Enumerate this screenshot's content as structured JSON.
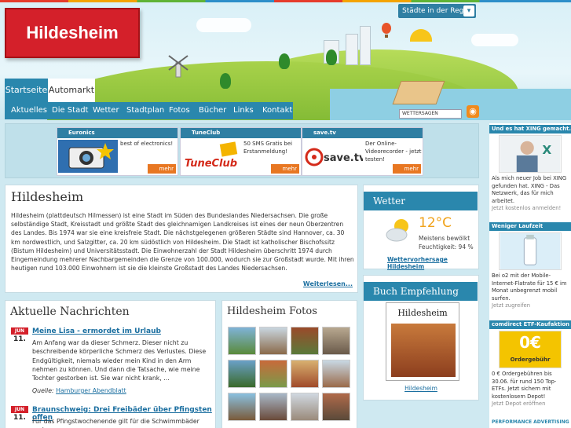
{
  "header": {
    "logo_text": "Hildesheim",
    "region_button": "Städte in der Region",
    "wetter_badge": "WETTERSAGEN"
  },
  "tabs": [
    {
      "label": "Startseite"
    },
    {
      "label": "Automarkt"
    }
  ],
  "subnav": [
    {
      "label": "Aktuelles"
    },
    {
      "label": "Die Stadt"
    },
    {
      "label": "Wetter"
    },
    {
      "label": "Stadtplan"
    },
    {
      "label": "Fotos"
    },
    {
      "label": "Bücher"
    },
    {
      "label": "Links"
    },
    {
      "label": "Kontakt"
    }
  ],
  "ads": [
    {
      "title": "Euronics",
      "text": "best of electronics!",
      "more": "mehr"
    },
    {
      "title": "TuneClub",
      "text": "50 SMS Gratis bei Erstanmeldung!",
      "more": "mehr"
    },
    {
      "title": "save.tv",
      "text": "Der Online-Videorecorder - jetzt testen!",
      "more": "mehr"
    }
  ],
  "intro": {
    "title": "Hildesheim",
    "text": "Hildesheim (plattdeutsch Hilmessen) ist eine Stadt im Süden des Bundeslandes Niedersachsen. Die große selbständige Stadt, Kreisstadt und größte Stadt des gleichnamigen Landkreises ist eines der neun Oberzentren des Landes. Bis 1974 war sie eine kreisfreie Stadt. Die nächstgelegenen größeren Städte sind Hannover, ca. 30 km nordwestlich, und Salzgitter, ca. 20 km südöstlich von Hildesheim. Die Stadt ist katholischer Bischofssitz (Bistum Hildesheim) und Universitätsstadt. Die Einwohnerzahl der Stadt Hildesheim überschritt 1974 durch Eingemeindung mehrerer Nachbargemeinden die Grenze von 100.000, wodurch sie zur Großstadt wurde. Mit ihren heutigen rund 103.000 Einwohnern ist sie die kleinste Großstadt des Landes Niedersachsen.",
    "more": "Weiterlesen..."
  },
  "news": {
    "title": "Aktuelle Nachrichten",
    "items": [
      {
        "month": "JUN",
        "day": "11.",
        "title": "Meine Lisa - ermordet im Urlaub",
        "text": "Am Anfang war da dieser Schmerz. Dieser nicht zu beschreibende körperliche Schmerz des Verlustes. Diese Endgültigkeit, niemals wieder mein Kind in den Arm nehmen zu können. Und dann die Tatsache, wie meine Tochter gestorben ist. Sie war nicht krank, ...",
        "source_label": "Quelle:",
        "source": "Hamburger Abendblatt"
      },
      {
        "month": "JUN",
        "day": "11.",
        "title": "Braunschweig: Drei Freibäder über Pfingsten offen",
        "text": "Für das Pfingstwochenende gilt für die Schwimmbäder und"
      }
    ]
  },
  "fotos": {
    "title": "Hildesheim Fotos"
  },
  "wetter": {
    "title": "Wetter",
    "temp": "12°C",
    "desc1": "Meistens bewölkt",
    "desc2": "Feuchtigkeit: 94 %",
    "link": "Wettervorhersage Hildesheim"
  },
  "buch": {
    "title": "Buch Empfehlung",
    "cover_title": "Hildesheim",
    "link": "Hildesheim"
  },
  "sidebar": [
    {
      "title": "Und es hat XING gemacht.",
      "text": "Als mich neuer Job bei XING gefunden hat. XING - Das Netzwerk, das für mich arbeitet.",
      "cta": "Jetzt kostenlos anmelden!"
    },
    {
      "title": "Weniger Laufzeit",
      "text": "Bei o2 mit der Mobile-Internet-Flatrate für 15 € im Monat unbegrenzt mobil surfen.",
      "cta": "Jetzt zugreifen"
    },
    {
      "title": "comdirect ETF-Kaufaktion",
      "badge1": "0€",
      "badge2": "Ordergebühr",
      "text": "0 € Ordergebühren bis 30.06. für rund 150 Top-ETFs. Jetzt sichern mit kostenlosem Depot!",
      "cta": "Jetzt Depot eröffnen"
    }
  ],
  "sidebar_footer": "PERFORMANCE ADVERTISING",
  "colors": {
    "brand_red": "#d4202a",
    "nav_blue": "#2a87ad",
    "link_blue": "#1b6fa0",
    "accent_orange": "#e87722"
  }
}
